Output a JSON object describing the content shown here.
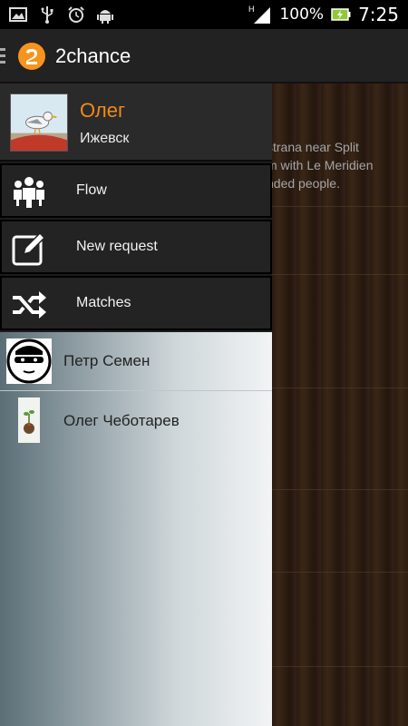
{
  "status_bar": {
    "battery_text": "100%",
    "time": "7:25",
    "network_indicator": "H",
    "left_icons": [
      "image-icon",
      "usb-icon",
      "alarm-icon",
      "android-icon"
    ],
    "right_icons": [
      "signal-icon",
      "battery-charging-icon"
    ]
  },
  "action_bar": {
    "title": "2chance",
    "logo_icon": "app-logo-icon",
    "menu_icon": "drawer-menu-icon",
    "accent_color": "#f7941d"
  },
  "drawer": {
    "profile": {
      "name": "Олег",
      "city": "Ижевск",
      "name_color": "#f08a1c"
    },
    "menu": [
      {
        "label": "Flow",
        "icon": "people-group-icon"
      },
      {
        "label": "New request",
        "icon": "edit-icon"
      },
      {
        "label": "Matches",
        "icon": "shuffle-icon"
      }
    ],
    "contacts": [
      {
        "name": "Петр Семен",
        "avatar": "masked-man-avatar"
      },
      {
        "name": "Олег Чеботарев",
        "avatar": "plant-pot-avatar"
      }
    ]
  },
  "background_content": {
    "post_lines": [
      "strana near Split",
      "m with Le Meridien",
      "nded people."
    ]
  }
}
